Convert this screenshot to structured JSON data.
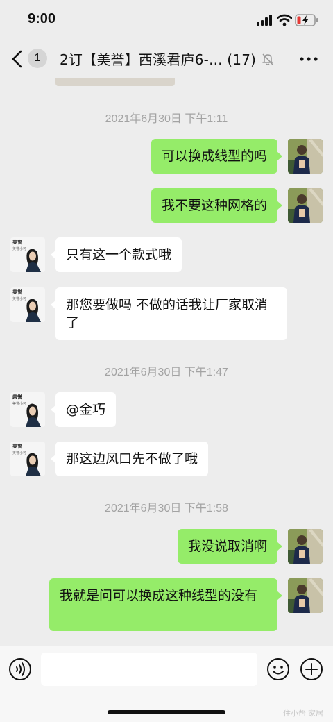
{
  "status": {
    "time": "9:00"
  },
  "header": {
    "unread_count": "1",
    "title": "2订【美誉】西溪君庐6-... (17)"
  },
  "messages": [
    {
      "type": "timestamp",
      "text": "2021年6月30日 下午1:11"
    },
    {
      "type": "msg",
      "side": "right",
      "text": "可以换成线型的吗"
    },
    {
      "type": "msg",
      "side": "right",
      "text": "我不要这种网格的"
    },
    {
      "type": "msg",
      "side": "left",
      "text": "只有这一个款式哦"
    },
    {
      "type": "msg",
      "side": "left",
      "text": "那您要做吗 不做的话我让厂家取消了"
    },
    {
      "type": "timestamp",
      "text": "2021年6月30日 下午1:47"
    },
    {
      "type": "msg",
      "side": "left",
      "text": "@金巧"
    },
    {
      "type": "msg",
      "side": "left",
      "text": "那这边风口先不做了哦"
    },
    {
      "type": "timestamp",
      "text": "2021年6月30日 下午1:58"
    },
    {
      "type": "msg",
      "side": "right",
      "text": "我没说取消啊"
    },
    {
      "type": "msg",
      "side": "right",
      "text": "我就是问可以换成这种线型的没有"
    }
  ],
  "avatar_her": {
    "label": "美誉",
    "sublabel": "美誉小可"
  },
  "watermark": "住小帮 家居",
  "colors": {
    "my_bubble": "#95ec69",
    "their_bubble": "#ffffff",
    "background": "#ededed"
  },
  "icons": [
    "back-chevron-icon",
    "mute-bell-icon",
    "more-dots-icon",
    "voice-icon",
    "emoji-icon",
    "plus-icon"
  ]
}
